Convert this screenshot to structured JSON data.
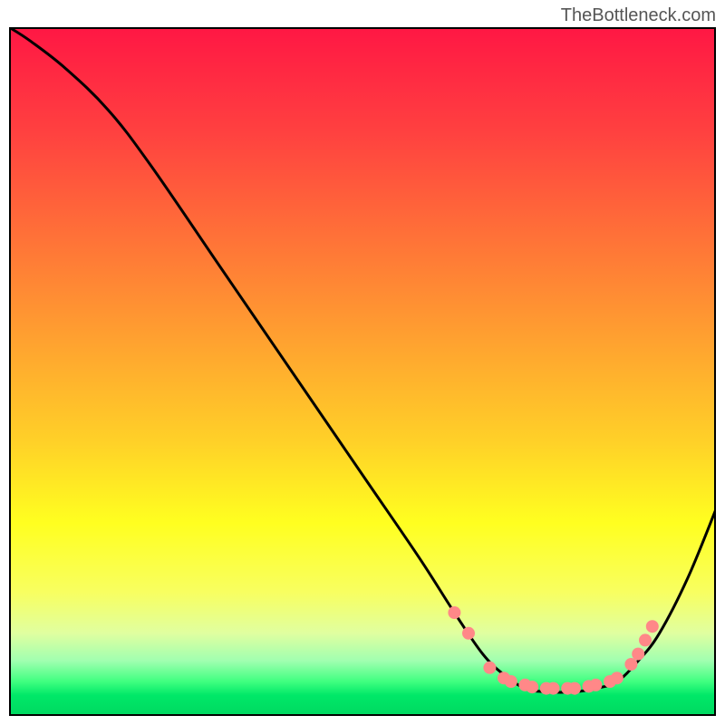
{
  "watermark": "TheBottleneck.com",
  "chart_data": {
    "type": "line",
    "title": "",
    "xlabel": "",
    "ylabel": "",
    "xlim": [
      0,
      100
    ],
    "ylim": [
      0,
      100
    ],
    "gradient_stops": [
      {
        "offset": 0,
        "color": "#ff1744"
      },
      {
        "offset": 15,
        "color": "#ff4040"
      },
      {
        "offset": 30,
        "color": "#ff7038"
      },
      {
        "offset": 45,
        "color": "#ffa030"
      },
      {
        "offset": 60,
        "color": "#ffd028"
      },
      {
        "offset": 72,
        "color": "#ffff20"
      },
      {
        "offset": 82,
        "color": "#f8ff60"
      },
      {
        "offset": 88,
        "color": "#e0ffa0"
      },
      {
        "offset": 92,
        "color": "#a0ffb0"
      },
      {
        "offset": 95,
        "color": "#40ff80"
      },
      {
        "offset": 97,
        "color": "#00e868"
      },
      {
        "offset": 100,
        "color": "#00d860"
      }
    ],
    "curve": [
      {
        "x": 0,
        "y": 100
      },
      {
        "x": 3,
        "y": 98
      },
      {
        "x": 8,
        "y": 94
      },
      {
        "x": 14,
        "y": 88
      },
      {
        "x": 20,
        "y": 80
      },
      {
        "x": 30,
        "y": 65
      },
      {
        "x": 40,
        "y": 50
      },
      {
        "x": 50,
        "y": 35
      },
      {
        "x": 58,
        "y": 23
      },
      {
        "x": 63,
        "y": 15
      },
      {
        "x": 67,
        "y": 9
      },
      {
        "x": 70,
        "y": 6
      },
      {
        "x": 73,
        "y": 4
      },
      {
        "x": 76,
        "y": 3.5
      },
      {
        "x": 80,
        "y": 3.5
      },
      {
        "x": 83,
        "y": 4
      },
      {
        "x": 86,
        "y": 5
      },
      {
        "x": 89,
        "y": 8
      },
      {
        "x": 92,
        "y": 12
      },
      {
        "x": 96,
        "y": 20
      },
      {
        "x": 100,
        "y": 30
      }
    ],
    "scatter_points": [
      {
        "x": 63,
        "y": 15
      },
      {
        "x": 65,
        "y": 12
      },
      {
        "x": 68,
        "y": 7
      },
      {
        "x": 70,
        "y": 5.5
      },
      {
        "x": 71,
        "y": 5
      },
      {
        "x": 73,
        "y": 4.5
      },
      {
        "x": 74,
        "y": 4.2
      },
      {
        "x": 76,
        "y": 4
      },
      {
        "x": 77,
        "y": 4
      },
      {
        "x": 79,
        "y": 4
      },
      {
        "x": 80,
        "y": 4
      },
      {
        "x": 82,
        "y": 4.3
      },
      {
        "x": 83,
        "y": 4.5
      },
      {
        "x": 85,
        "y": 5
      },
      {
        "x": 86,
        "y": 5.5
      },
      {
        "x": 88,
        "y": 7.5
      },
      {
        "x": 89,
        "y": 9
      },
      {
        "x": 90,
        "y": 11
      },
      {
        "x": 91,
        "y": 13
      }
    ],
    "point_color": "#ff8888",
    "point_radius": 7
  }
}
